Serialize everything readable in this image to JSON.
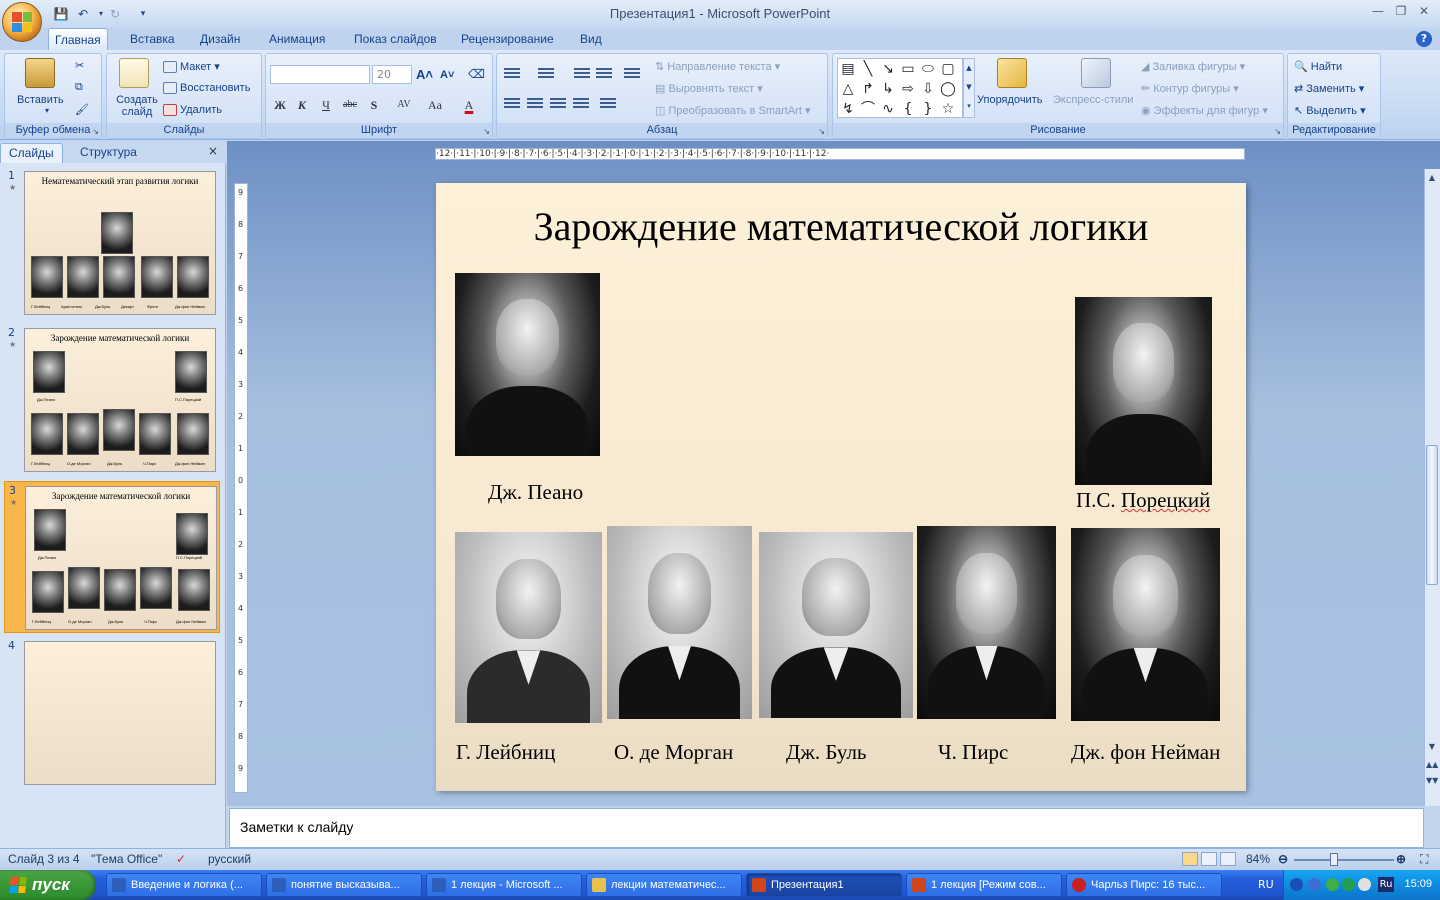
{
  "app": {
    "window_title": "Презентация1 - Microsoft PowerPoint",
    "tabs": [
      "Главная",
      "Вставка",
      "Дизайн",
      "Анимация",
      "Показ слайдов",
      "Рецензирование",
      "Вид"
    ],
    "active_tab": "Главная"
  },
  "ribbon": {
    "clipboard": {
      "label": "Буфер обмена",
      "paste": "Вставить"
    },
    "slides": {
      "label": "Слайды",
      "new_slide": "Создать слайд",
      "layout": "Макет",
      "reset": "Восстановить",
      "delete": "Удалить"
    },
    "font": {
      "label": "Шрифт",
      "font_name": "",
      "font_size": "20",
      "bold": "Ж",
      "italic": "К",
      "underline": "Ч",
      "strike": "abc",
      "shadow": "S",
      "spacing": "AV",
      "case": "Aa",
      "color": "A"
    },
    "paragraph": {
      "label": "Абзац",
      "text_direction": "Направление текста",
      "align_text": "Выровнять текст",
      "smartart": "Преобразовать в SmartArt"
    },
    "drawing": {
      "label": "Рисование",
      "arrange": "Упорядочить",
      "quick_styles": "Экспресс-стили",
      "shape_fill": "Заливка фигуры",
      "shape_outline": "Контур фигуры",
      "shape_effects": "Эффекты для фигур"
    },
    "editing": {
      "label": "Редактирование",
      "find": "Найти",
      "replace": "Заменить",
      "select": "Выделить"
    }
  },
  "left_pane": {
    "tab_slides": "Слайды",
    "tab_outline": "Структура",
    "close": "×",
    "slides": [
      {
        "num": "1",
        "title": "Нематематический этап развития логики",
        "captions": [
          "Г.Лейбниц",
          "Аристотель",
          "Дж.Буль",
          "Декарт",
          "Фреге",
          "Дж.фон Нейман"
        ]
      },
      {
        "num": "2",
        "title": "Зарождение математической логики",
        "captions": [
          "Дж.Пеано",
          "П.С.Порецкий",
          "Г.Лейбниц",
          "О.де Морган",
          "Дж.Буль",
          "Ч.Пирс",
          "Дж.фон Нейман"
        ]
      },
      {
        "num": "3",
        "title": "Зарождение математической логики",
        "captions": [
          "Дж.Пеано",
          "П.С.Порецкий",
          "Г.Лейбниц",
          "О.де Морган",
          "Дж.Буль",
          "Ч.Пирс",
          "Дж.фон Нейман"
        ],
        "selected": true
      },
      {
        "num": "4",
        "title": "",
        "captions": []
      }
    ]
  },
  "ruler": {
    "h_ticks": "·12·|·11·|·10·|·9·|·8·|·7·|·6·|·5·|·4·|·3·|·2·|·1·|·0·|·1·|·2·|·3·|·4·|·5·|·6·|·7·|·8·|·9·|·10·|·11·|·12·",
    "v_ticks": [
      "9",
      "8",
      "7",
      "6",
      "5",
      "4",
      "3",
      "2",
      "1",
      "0",
      "1",
      "2",
      "3",
      "4",
      "5",
      "6",
      "7",
      "8",
      "9"
    ]
  },
  "slide": {
    "title": "Зарождение математической логики",
    "people": {
      "peano": "Дж. Пеано",
      "poretsky_prefix": "П.С. ",
      "poretsky_name": "Порецкий",
      "leibniz": "Г. Лейбниц",
      "de_morgan": "О. де Морган",
      "boole": "Дж. Буль",
      "peirce": "Ч. Пирс",
      "von_neumann": "Дж. фон Нейман"
    }
  },
  "notes": {
    "placeholder": "Заметки к слайду"
  },
  "status": {
    "slide_pos": "Слайд 3 из 4",
    "theme": "\"Тема Office\"",
    "language": "русский",
    "zoom": "84%"
  },
  "taskbar": {
    "start": "пуск",
    "tasks": [
      {
        "label": "Введение и логика (...",
        "color": "#2b5fb8"
      },
      {
        "label": "понятие высказыва...",
        "color": "#2b5fb8"
      },
      {
        "label": "1 лекция - Microsoft ...",
        "color": "#2b5fb8"
      },
      {
        "label": "лекции математичес...",
        "color": "#e8c14a"
      },
      {
        "label": "Презентация1",
        "color": "#d0451b",
        "active": true
      },
      {
        "label": "1 лекция [Режим сов...",
        "color": "#d0451b"
      },
      {
        "label": "Чарльз Пирс: 16 тыс...",
        "color": "#cc1f1f"
      }
    ],
    "lang": "RU",
    "tray_lang": "Ru",
    "clock": "15:09"
  }
}
